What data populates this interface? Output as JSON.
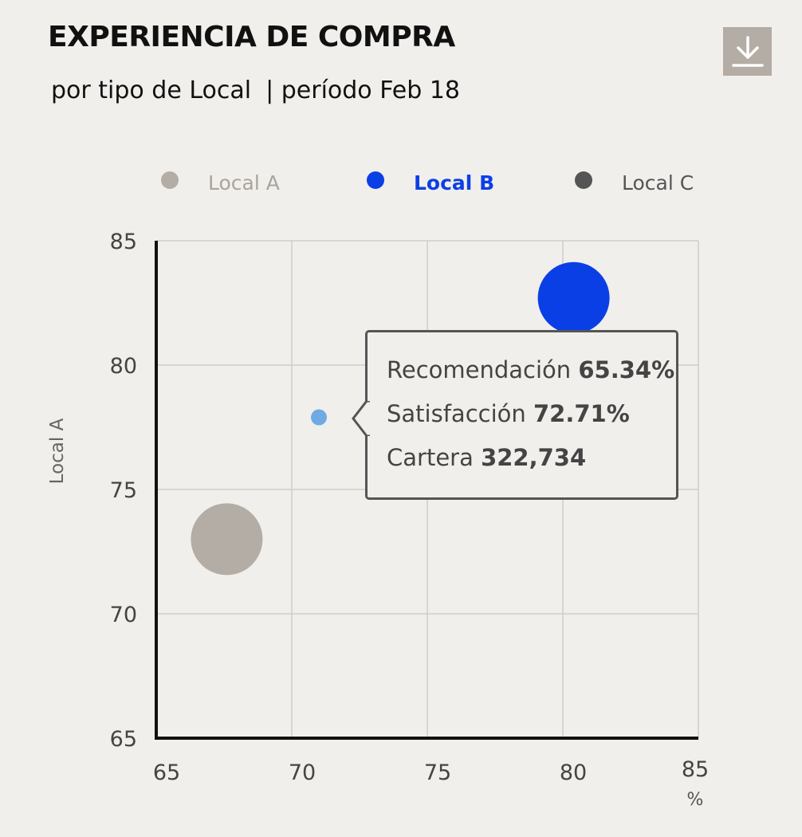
{
  "header": {
    "title": "EXPERIENCIA DE COMPRA",
    "subtitle": "por tipo de Local",
    "period": "| período Feb 18"
  },
  "download_icon": "download-icon",
  "tooltip": {
    "rows": [
      {
        "label": "Recomendación",
        "value": "65.34%"
      },
      {
        "label": "Satisfacción",
        "value": "72.71%"
      },
      {
        "label": "Cartera",
        "value": "322,734"
      }
    ]
  },
  "chart_data": {
    "type": "scatter",
    "title": "EXPERIENCIA DE COMPRA",
    "xlabel": "%",
    "ylabel": "Local A",
    "xlim": [
      65,
      85
    ],
    "ylim": [
      65,
      85
    ],
    "x_ticks": [
      65,
      70,
      75,
      80,
      85
    ],
    "y_ticks": [
      65,
      70,
      75,
      80,
      85
    ],
    "grid": true,
    "legend_position": "top",
    "series": [
      {
        "name": "Local A",
        "color": "#b3ada5",
        "active": false,
        "points": [
          {
            "x": 67.6,
            "y": 73.0,
            "size": "large"
          }
        ]
      },
      {
        "name": "Local B",
        "color": "#0b3fe6",
        "active": true,
        "points": [
          {
            "x": 80.4,
            "y": 82.7,
            "size": "large"
          }
        ]
      },
      {
        "name": "Local C",
        "color": "#555555",
        "active": false,
        "points": []
      }
    ],
    "highlight_point": {
      "x": 71.0,
      "y": 77.9,
      "color": "#6faae2"
    }
  }
}
